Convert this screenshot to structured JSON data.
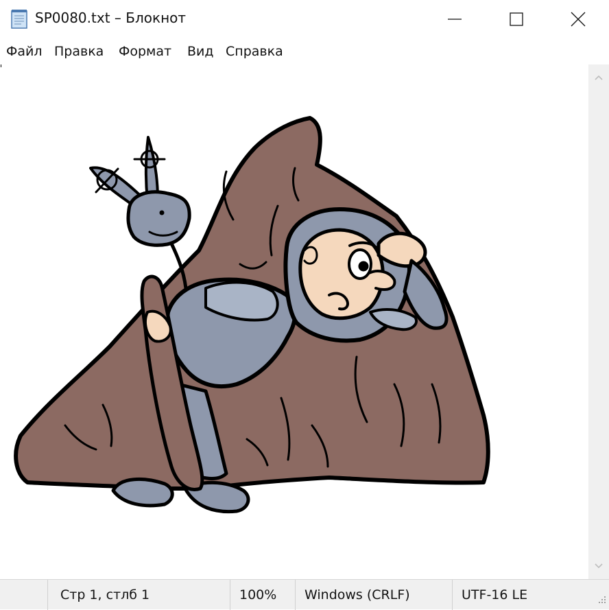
{
  "window": {
    "title": "SP0080.txt – Блокнот",
    "controls": {
      "minimize": "minimize",
      "maximize": "maximize",
      "close": "close"
    }
  },
  "menu": [
    "Файл",
    "Правка",
    "Формат",
    "Вид",
    "Справка"
  ],
  "editor": {
    "content_description_icon": "ascii-art-cartoon-knight-behind-rock"
  },
  "status": {
    "position": "Стр 1, стлб 1",
    "zoom": "100%",
    "line_endings": "Windows (CRLF)",
    "encoding": "UTF-16 LE"
  },
  "colors": {
    "rock": "#8c6a62",
    "armor": "#8e98ac",
    "armor_light": "#a9b4c6",
    "skin": "#f5d8bd",
    "outline": "#000000"
  }
}
